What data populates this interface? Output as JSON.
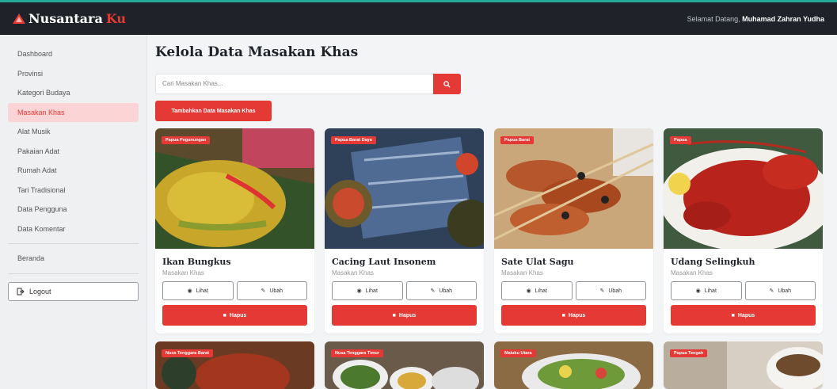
{
  "brand": {
    "name": "Nusantara",
    "accent": "Ku"
  },
  "header": {
    "welcome_prefix": "Selamat Datang,",
    "user_name": "Muhamad Zahran Yudha"
  },
  "sidebar": {
    "items": [
      {
        "label": "Dashboard",
        "active": false
      },
      {
        "label": "Provinsi",
        "active": false
      },
      {
        "label": "Kategori Budaya",
        "active": false
      },
      {
        "label": "Masakan Khas",
        "active": true
      },
      {
        "label": "Alat Musik",
        "active": false
      },
      {
        "label": "Pakaian Adat",
        "active": false
      },
      {
        "label": "Rumah Adat",
        "active": false
      },
      {
        "label": "Tari Tradisional",
        "active": false
      },
      {
        "label": "Data Pengguna",
        "active": false
      },
      {
        "label": "Data Komentar",
        "active": false
      }
    ],
    "home": "Beranda",
    "logout": "Logout"
  },
  "main": {
    "title": "Kelola Data Masakan Khas",
    "search_placeholder": "Cari Masakan Khas...",
    "add_button": "Tambahkan Data Masakan Khas"
  },
  "cards": [
    {
      "region": "Papua Pegunungan",
      "name": "Ikan Bungkus",
      "category": "Masakan Khas",
      "view": "Lihat",
      "edit": "Ubah",
      "delete": "Hapus"
    },
    {
      "region": "Papua Barat Daya",
      "name": "Cacing Laut Insonem",
      "category": "Masakan Khas",
      "view": "Lihat",
      "edit": "Ubah",
      "delete": "Hapus"
    },
    {
      "region": "Papua Barat",
      "name": "Sate Ulat Sagu",
      "category": "Masakan Khas",
      "view": "Lihat",
      "edit": "Ubah",
      "delete": "Hapus"
    },
    {
      "region": "Papua",
      "name": "Udang Selingkuh",
      "category": "Masakan Khas",
      "view": "Lihat",
      "edit": "Ubah",
      "delete": "Hapus"
    }
  ],
  "cards_second_row": [
    {
      "region": "Nusa Tenggara Barat"
    },
    {
      "region": "Nusa Tenggara Timur"
    },
    {
      "region": "Maluku Utara"
    },
    {
      "region": "Papua Tengah"
    }
  ],
  "colors": {
    "accent": "#e53935",
    "topbar": "#1f2329",
    "active_bg": "#fbd5d5"
  },
  "icons": {
    "brand": "temple-icon",
    "search": "search-icon",
    "logout": "logout-icon",
    "view": "eye-icon",
    "edit": "pencil-icon",
    "delete": "trash-icon",
    "badge": "pin-icon"
  }
}
